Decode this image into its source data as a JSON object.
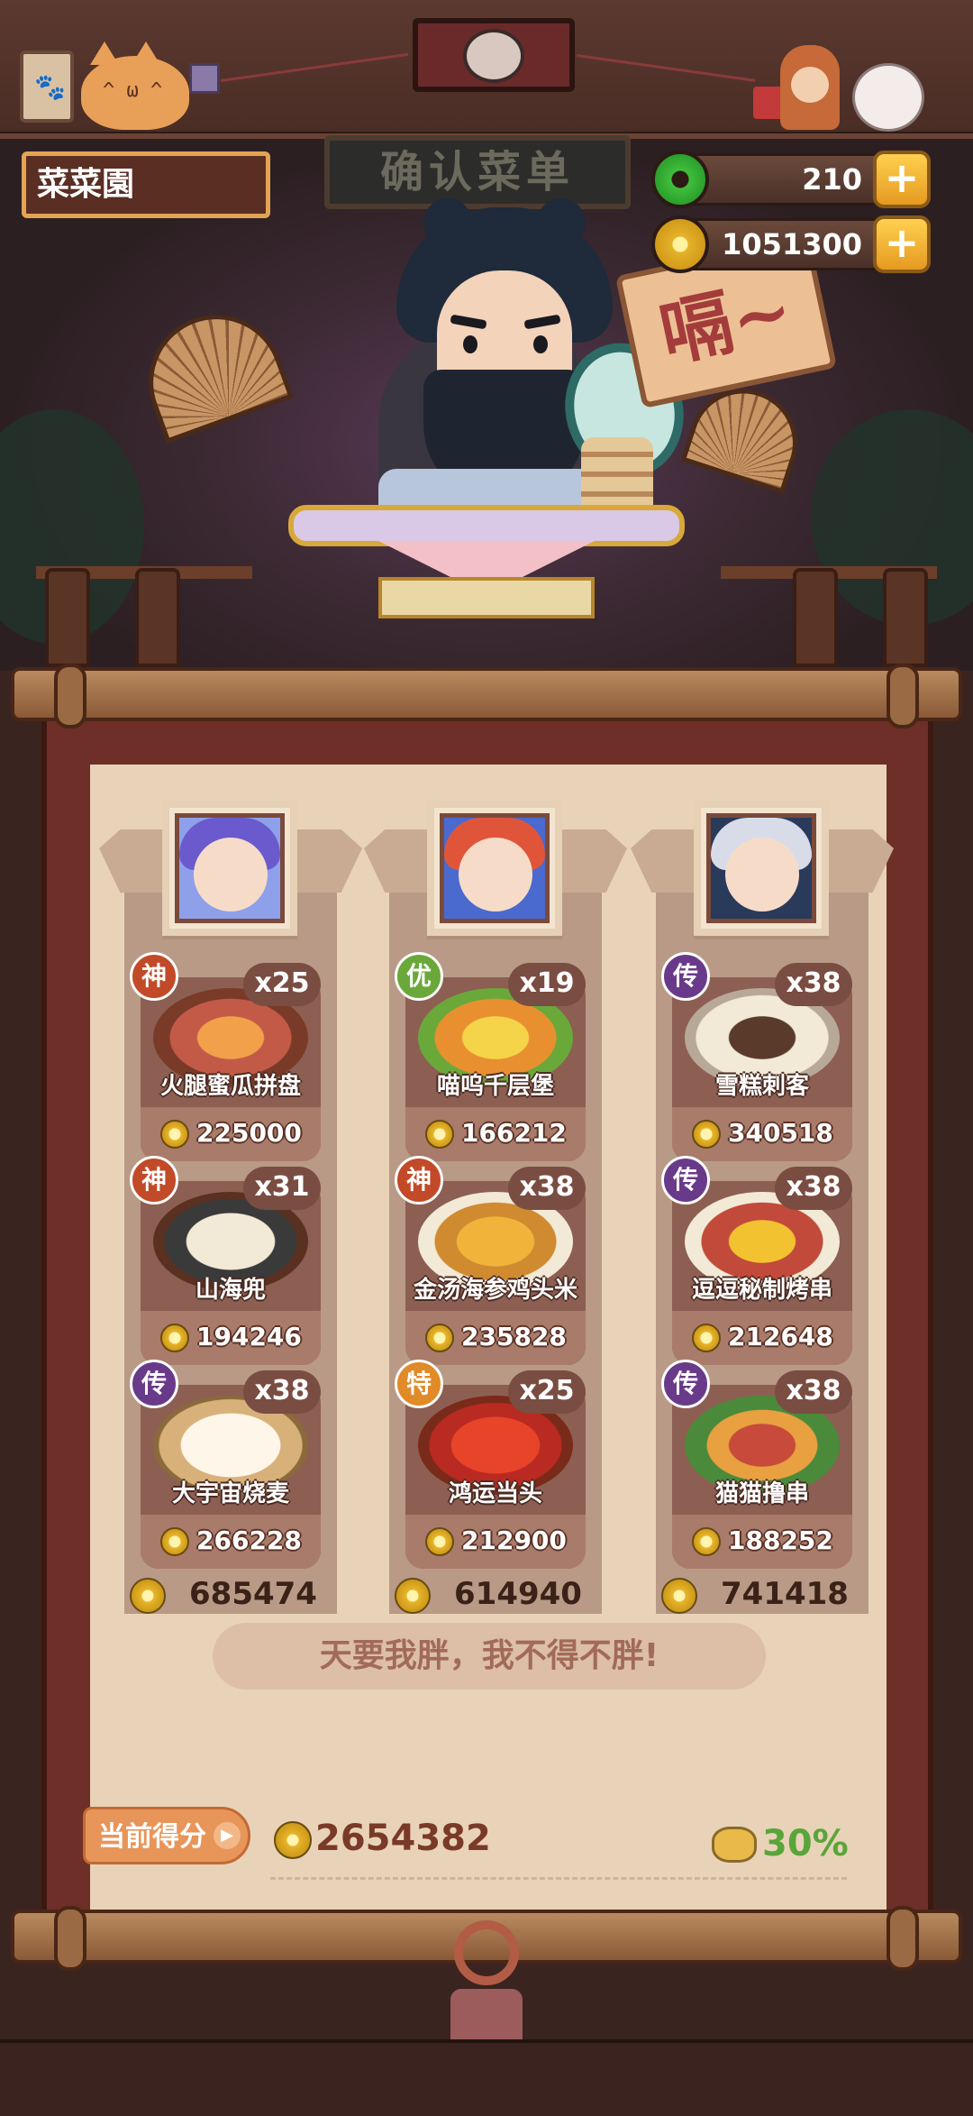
{
  "header": {
    "restaurant_name": "菜菜園",
    "sign_text": "确认菜单",
    "speech_bubble": "嗝~"
  },
  "currency": {
    "jade": "210",
    "gold": "1051300",
    "add_symbol": "+"
  },
  "columns": [
    {
      "total": "685474",
      "dishes": [
        {
          "name": "火腿蜜瓜拼盘",
          "price": "225000",
          "qty": "x25",
          "grade": "神",
          "grade_color": "#c24a28"
        },
        {
          "name": "山海兜",
          "price": "194246",
          "qty": "x31",
          "grade": "神",
          "grade_color": "#c24a28"
        },
        {
          "name": "大宇宙烧麦",
          "price": "266228",
          "qty": "x38",
          "grade": "传",
          "grade_color": "#6a3a8a"
        }
      ]
    },
    {
      "total": "614940",
      "dishes": [
        {
          "name": "喵呜千层堡",
          "price": "166212",
          "qty": "x19",
          "grade": "优",
          "grade_color": "#6aa83a"
        },
        {
          "name": "金汤海参鸡头米",
          "price": "235828",
          "qty": "x38",
          "grade": "神",
          "grade_color": "#c24a28"
        },
        {
          "name": "鸿运当头",
          "price": "212900",
          "qty": "x25",
          "grade": "特",
          "grade_color": "#e08a28"
        }
      ]
    },
    {
      "total": "741418",
      "dishes": [
        {
          "name": "雪糕刺客",
          "price": "340518",
          "qty": "x38",
          "grade": "传",
          "grade_color": "#6a3a8a"
        },
        {
          "name": "逗逗秘制烤串",
          "price": "212648",
          "qty": "x38",
          "grade": "传",
          "grade_color": "#6a3a8a"
        },
        {
          "name": "猫猫撸串",
          "price": "188252",
          "qty": "x38",
          "grade": "传",
          "grade_color": "#6a3a8a"
        }
      ]
    }
  ],
  "quote": "天要我胖，我不得不胖!",
  "score": {
    "label": "当前得分",
    "value": "2654382",
    "bonus": "30%"
  }
}
